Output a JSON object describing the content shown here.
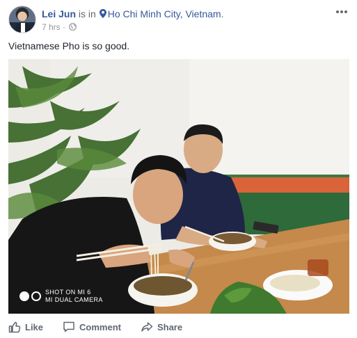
{
  "post": {
    "author": "Lei Jun",
    "is_in": "is in",
    "location": "Ho Chi Minh City, Vietnam",
    "location_suffix": ".",
    "time": "7 hrs",
    "separator": "·",
    "audience_icon": "globe-icon",
    "text": "Vietnamese Pho is so good."
  },
  "photo": {
    "watermark_line1": "SHOT ON MI 6",
    "watermark_line2": "MI DUAL CAMERA"
  },
  "actions": [
    {
      "label": "Like",
      "icon": "thumbs-up-icon"
    },
    {
      "label": "Comment",
      "icon": "speech-bubble-icon"
    },
    {
      "label": "Share",
      "icon": "share-arrow-icon"
    }
  ],
  "colors": {
    "link": "#365899",
    "muted": "#90949c",
    "action": "#606770"
  }
}
